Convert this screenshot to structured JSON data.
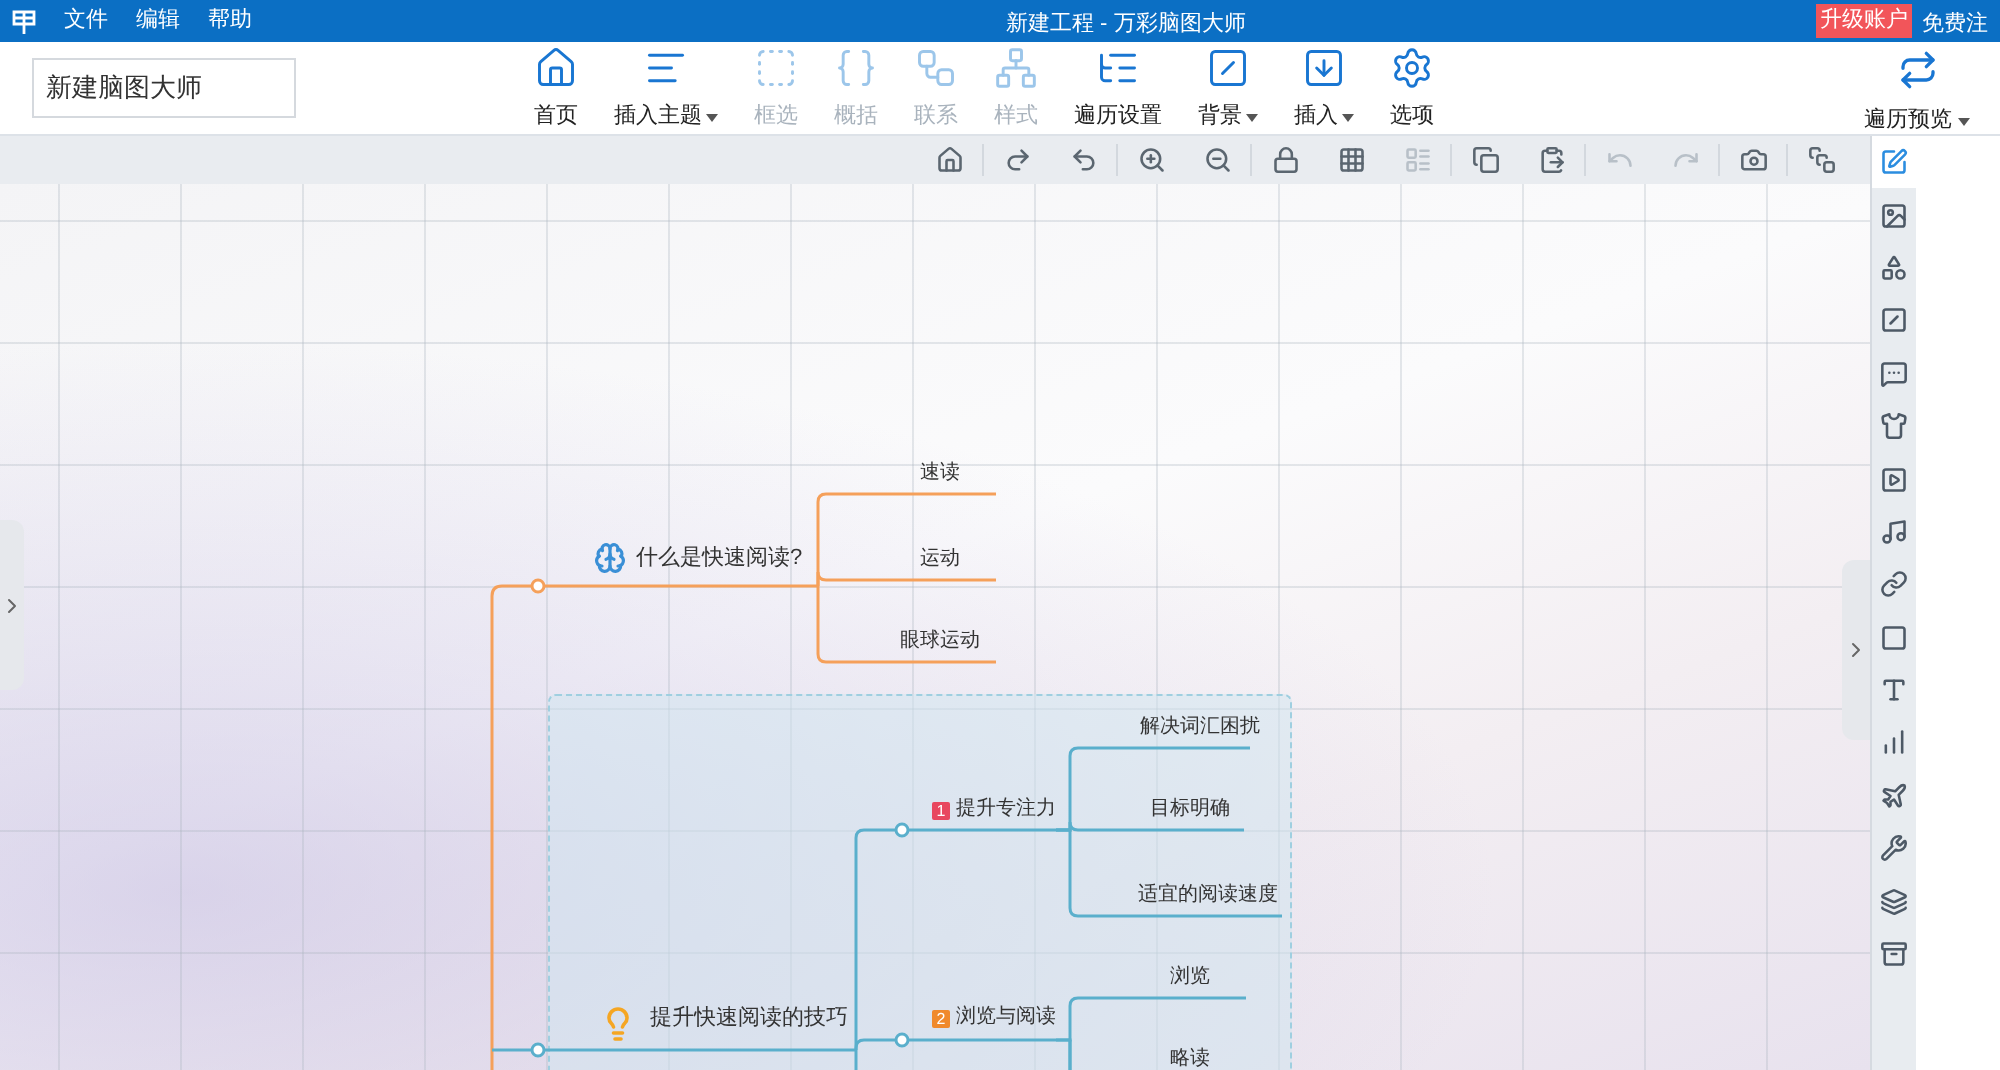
{
  "window": {
    "title": "新建工程 - 万彩脑图大师"
  },
  "menu": [
    "文件",
    "编辑",
    "帮助"
  ],
  "account": {
    "upgrade": "升级账户",
    "register": "免费注"
  },
  "document_name": {
    "value": "新建脑图大师"
  },
  "toolbar": [
    {
      "label": "首页",
      "disabled": false,
      "dropdown": false
    },
    {
      "label": "插入主题",
      "disabled": false,
      "dropdown": true
    },
    {
      "label": "框选",
      "disabled": true,
      "dropdown": false
    },
    {
      "label": "概括",
      "disabled": true,
      "dropdown": false
    },
    {
      "label": "联系",
      "disabled": true,
      "dropdown": false
    },
    {
      "label": "样式",
      "disabled": true,
      "dropdown": false
    },
    {
      "label": "遍历设置",
      "disabled": false,
      "dropdown": false
    },
    {
      "label": "背景",
      "disabled": false,
      "dropdown": true
    },
    {
      "label": "插入",
      "disabled": false,
      "dropdown": true
    },
    {
      "label": "选项",
      "disabled": false,
      "dropdown": false
    }
  ],
  "preview_button": {
    "label": "遍历预览",
    "dropdown": true
  },
  "canvas_toolbar": [
    {
      "disabled": false
    },
    {
      "disabled": false
    },
    {
      "disabled": false
    },
    {
      "disabled": false
    },
    {
      "disabled": false
    },
    {
      "disabled": false
    },
    {
      "disabled": false
    },
    {
      "disabled": true
    },
    {
      "disabled": false
    },
    {
      "disabled": false
    },
    {
      "disabled": true
    },
    {
      "disabled": true
    },
    {
      "disabled": false
    },
    {
      "disabled": false
    }
  ],
  "side_panel": [
    {
      "selected": true
    },
    {
      "selected": false
    },
    {
      "selected": false
    },
    {
      "selected": false
    },
    {
      "selected": false
    },
    {
      "selected": false
    },
    {
      "selected": false
    },
    {
      "selected": false
    },
    {
      "selected": false
    },
    {
      "selected": false
    },
    {
      "selected": false
    },
    {
      "selected": false
    },
    {
      "selected": false
    },
    {
      "selected": false
    },
    {
      "selected": false
    },
    {
      "selected": false
    }
  ],
  "mind_map": {
    "topics": [
      {
        "text": "什么是快速阅读?",
        "color": "#f5a05a",
        "children": [
          {
            "text": "速读"
          },
          {
            "text": "运动"
          },
          {
            "text": "眼球运动"
          }
        ]
      },
      {
        "text": "提升快速阅读的技巧",
        "color": "#5aafcc",
        "grouped": true,
        "children": [
          {
            "text": "提升专注力",
            "badge": "1",
            "color": "#e8475f",
            "children": [
              {
                "text": "解决词汇困扰"
              },
              {
                "text": "目标明确"
              },
              {
                "text": "适宜的阅读速度"
              }
            ]
          },
          {
            "text": "浏览与阅读",
            "badge": "2",
            "color": "#f08a2c",
            "children": [
              {
                "text": "浏览"
              },
              {
                "text": "略读"
              }
            ]
          }
        ]
      }
    ]
  }
}
